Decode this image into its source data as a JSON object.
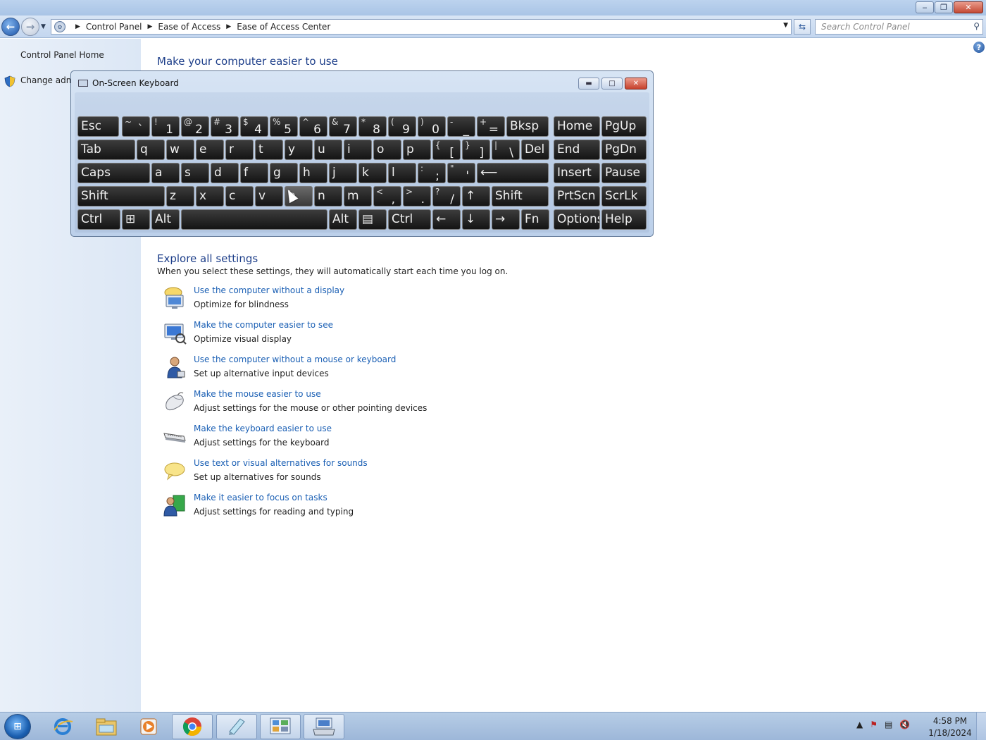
{
  "window": {
    "min": "‒",
    "max": "❐",
    "close": "✕"
  },
  "address": {
    "crumbs": [
      "Control Panel",
      "Ease of Access",
      "Ease of Access Center"
    ],
    "search_placeholder": "Search Control Panel"
  },
  "left_pane": {
    "home": "Control Panel Home",
    "change_admin": "Change admi"
  },
  "main": {
    "heading": "Make your computer easier to use",
    "section_title": "Explore all settings",
    "section_desc": "When you select these settings, they will automatically start each time you log on.",
    "settings": [
      {
        "link": "Use the computer without a display",
        "desc": "Optimize for blindness",
        "icon": "display-icon"
      },
      {
        "link": "Make the computer easier to see",
        "desc": "Optimize visual display",
        "icon": "monitor-icon"
      },
      {
        "link": "Use the computer without a mouse or keyboard",
        "desc": "Set up alternative input devices",
        "icon": "user-icon"
      },
      {
        "link": "Make the mouse easier to use",
        "desc": "Adjust settings for the mouse or other pointing devices",
        "icon": "mouse-icon"
      },
      {
        "link": "Make the keyboard easier to use",
        "desc": "Adjust settings for the keyboard",
        "icon": "keyboard-icon"
      },
      {
        "link": "Use text or visual alternatives for sounds",
        "desc": "Set up alternatives for sounds",
        "icon": "speech-bubble-icon"
      },
      {
        "link": "Make it easier to focus on tasks",
        "desc": "Adjust settings for reading and typing",
        "icon": "focus-icon"
      }
    ]
  },
  "osk": {
    "title": "On-Screen Keyboard",
    "rows": [
      [
        {
          "label": "Esc"
        },
        {
          "sup": "~",
          "main": "`"
        },
        {
          "sup": "!",
          "main": "1"
        },
        {
          "sup": "@",
          "main": "2"
        },
        {
          "sup": "#",
          "main": "3"
        },
        {
          "sup": "$",
          "main": "4"
        },
        {
          "sup": "%",
          "main": "5"
        },
        {
          "sup": "^",
          "main": "6"
        },
        {
          "sup": "&",
          "main": "7"
        },
        {
          "sup": "*",
          "main": "8"
        },
        {
          "sup": "(",
          "main": "9"
        },
        {
          "sup": ")",
          "main": "0"
        },
        {
          "sup": "-",
          "main": "_"
        },
        {
          "sup": "+",
          "main": "="
        },
        {
          "label": "Bksp"
        },
        {
          "label": "Home"
        },
        {
          "label": "PgUp"
        }
      ],
      [
        {
          "label": "Tab"
        },
        {
          "label": "q"
        },
        {
          "label": "w"
        },
        {
          "label": "e"
        },
        {
          "label": "r"
        },
        {
          "label": "t"
        },
        {
          "label": "y"
        },
        {
          "label": "u"
        },
        {
          "label": "i"
        },
        {
          "label": "o"
        },
        {
          "label": "p"
        },
        {
          "sup": "{",
          "main": "["
        },
        {
          "sup": "}",
          "main": "]"
        },
        {
          "sup": "|",
          "main": "\\"
        },
        {
          "label": "Del"
        },
        {
          "label": "End"
        },
        {
          "label": "PgDn"
        }
      ],
      [
        {
          "label": "Caps"
        },
        {
          "label": "a"
        },
        {
          "label": "s"
        },
        {
          "label": "d"
        },
        {
          "label": "f"
        },
        {
          "label": "g"
        },
        {
          "label": "h"
        },
        {
          "label": "j"
        },
        {
          "label": "k"
        },
        {
          "label": "l"
        },
        {
          "sup": ":",
          "main": ";"
        },
        {
          "sup": "\"",
          "main": "'"
        },
        {
          "label": "⟵"
        },
        {
          "label": "Insert"
        },
        {
          "label": "Pause"
        }
      ],
      [
        {
          "label": "Shift"
        },
        {
          "label": "z"
        },
        {
          "label": "x"
        },
        {
          "label": "c"
        },
        {
          "label": "v"
        },
        {
          "label": "b"
        },
        {
          "label": "n"
        },
        {
          "label": "m"
        },
        {
          "sup": "<",
          "main": ","
        },
        {
          "sup": ">",
          "main": "."
        },
        {
          "sup": "?",
          "main": "/"
        },
        {
          "label": "↑"
        },
        {
          "label": "Shift"
        },
        {
          "label": "PrtScn"
        },
        {
          "label": "ScrLk"
        }
      ],
      [
        {
          "label": "Ctrl"
        },
        {
          "label": "⊞"
        },
        {
          "label": "Alt"
        },
        {
          "label": ""
        },
        {
          "label": "Alt"
        },
        {
          "label": "▤"
        },
        {
          "label": "Ctrl"
        },
        {
          "label": "←"
        },
        {
          "label": "↓"
        },
        {
          "label": "→"
        },
        {
          "label": "Fn"
        },
        {
          "label": "Options"
        },
        {
          "label": "Help"
        }
      ]
    ]
  },
  "taskbar": {
    "clock_time": "4:58 PM",
    "clock_date": "1/18/2024",
    "apps": [
      "internet-explorer-icon",
      "file-explorer-icon",
      "media-player-icon",
      "chrome-icon",
      "notepad-icon",
      "control-panel-icon",
      "on-screen-keyboard-icon"
    ]
  }
}
